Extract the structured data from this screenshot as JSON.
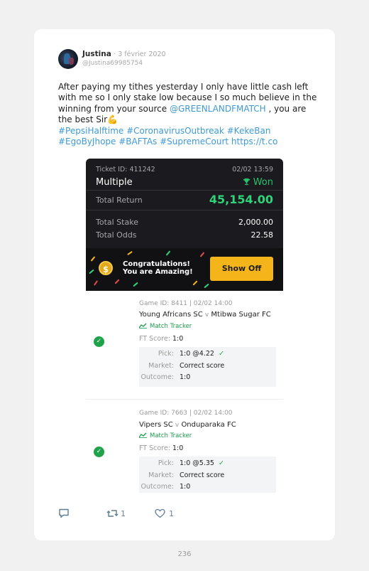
{
  "tweet": {
    "author": "Justina",
    "date": "· 3 février 2020",
    "handle": "@Justina69985754",
    "text_main": "After paying my tithes yesterday I only have little cash left with me so I only stake low because I so much believe in the winning from your source ",
    "mention": "@GREENLANDFMATCH",
    "text_tail": " , you are the best Sir",
    "emoji": "💪",
    "hashtags": "#PepsiHalftime #CoronavirusOutbreak #KekeBan #EgoByJhope #BAFTAs #SupremeCourt",
    "url": "https://t.co",
    "reply_count": "",
    "retweet_count": "1",
    "like_count": "1"
  },
  "ticket": {
    "id_label": "Ticket ID: 411242",
    "date": "02/02 13:59",
    "type": "Multiple",
    "status": "Won",
    "total_return_label": "Total Return",
    "total_return": "45,154.00",
    "total_stake_label": "Total Stake",
    "total_stake": "2,000.00",
    "total_odds_label": "Total Odds",
    "total_odds": "22.58",
    "coin_symbol": "$",
    "congrats_line1": "Congratulations!",
    "congrats_line2": "You are Amazing!",
    "show_off_label": "Show Off"
  },
  "games": [
    {
      "id_line": "Game ID: 8411 | 02/02 14:00",
      "home": "Young Africans SC",
      "vs": "v",
      "away": "Mtibwa Sugar FC",
      "tracker_label": "Match Tracker",
      "ft_label": "FT Score:",
      "ft_score": "1:0",
      "pick_label": "Pick:",
      "pick": "1:0 @4.22",
      "market_label": "Market:",
      "market": "Correct score",
      "outcome_label": "Outcome:",
      "outcome": "1:0"
    },
    {
      "id_line": "Game ID: 7663 | 02/02 14:00",
      "home": "Vipers SC",
      "vs": "v",
      "away": "Onduparaka FC",
      "tracker_label": "Match Tracker",
      "ft_label": "FT Score:",
      "ft_score": "1:0",
      "pick_label": "Pick:",
      "pick": "1:0 @5.35",
      "market_label": "Market:",
      "market": "Correct score",
      "outcome_label": "Outcome:",
      "outcome": "1:0"
    }
  ],
  "page_number": "236",
  "colors": {
    "link": "#3d9ad6",
    "won_green": "#27c06b",
    "return_green": "#2ed37a",
    "button_yellow": "#f5b51a",
    "dark_panel": "#1b1b1f",
    "check_green": "#1fa24a"
  },
  "icons": [
    "reply-icon",
    "retweet-icon",
    "heart-icon",
    "trophy-icon",
    "check-icon",
    "match-tracker-icon",
    "coin-icon"
  ]
}
